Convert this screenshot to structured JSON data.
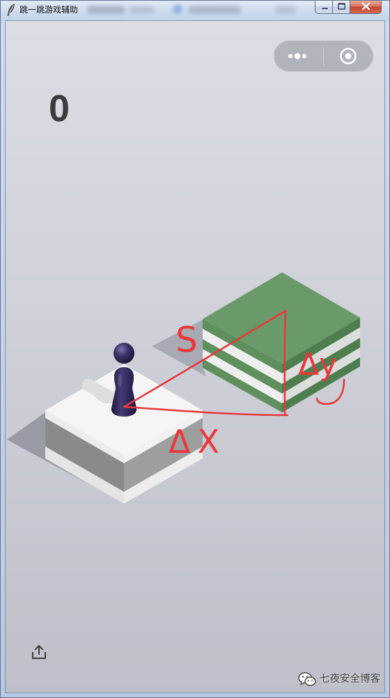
{
  "window": {
    "title": "跳一跳游戏辅助",
    "app_icon": "feather-icon",
    "controls": {
      "minimize": "minimize-icon",
      "maximize": "maximize-icon",
      "close": "close-icon"
    }
  },
  "game": {
    "score": "0",
    "capsule": {
      "menu_icon": "more-dots-icon",
      "exit_icon": "target-circle-icon"
    },
    "share_icon": "share-icon",
    "colors": {
      "start_block_top": "#f5f5f5",
      "target_block_top": "#6a9a69"
    }
  },
  "annotations": {
    "color": "#e8383b",
    "labels": {
      "distance": "S",
      "delta_y": "Δy",
      "delta_x": "ΔX"
    }
  },
  "watermark": {
    "icon": "wechat-icon",
    "text": "七夜安全博客"
  }
}
